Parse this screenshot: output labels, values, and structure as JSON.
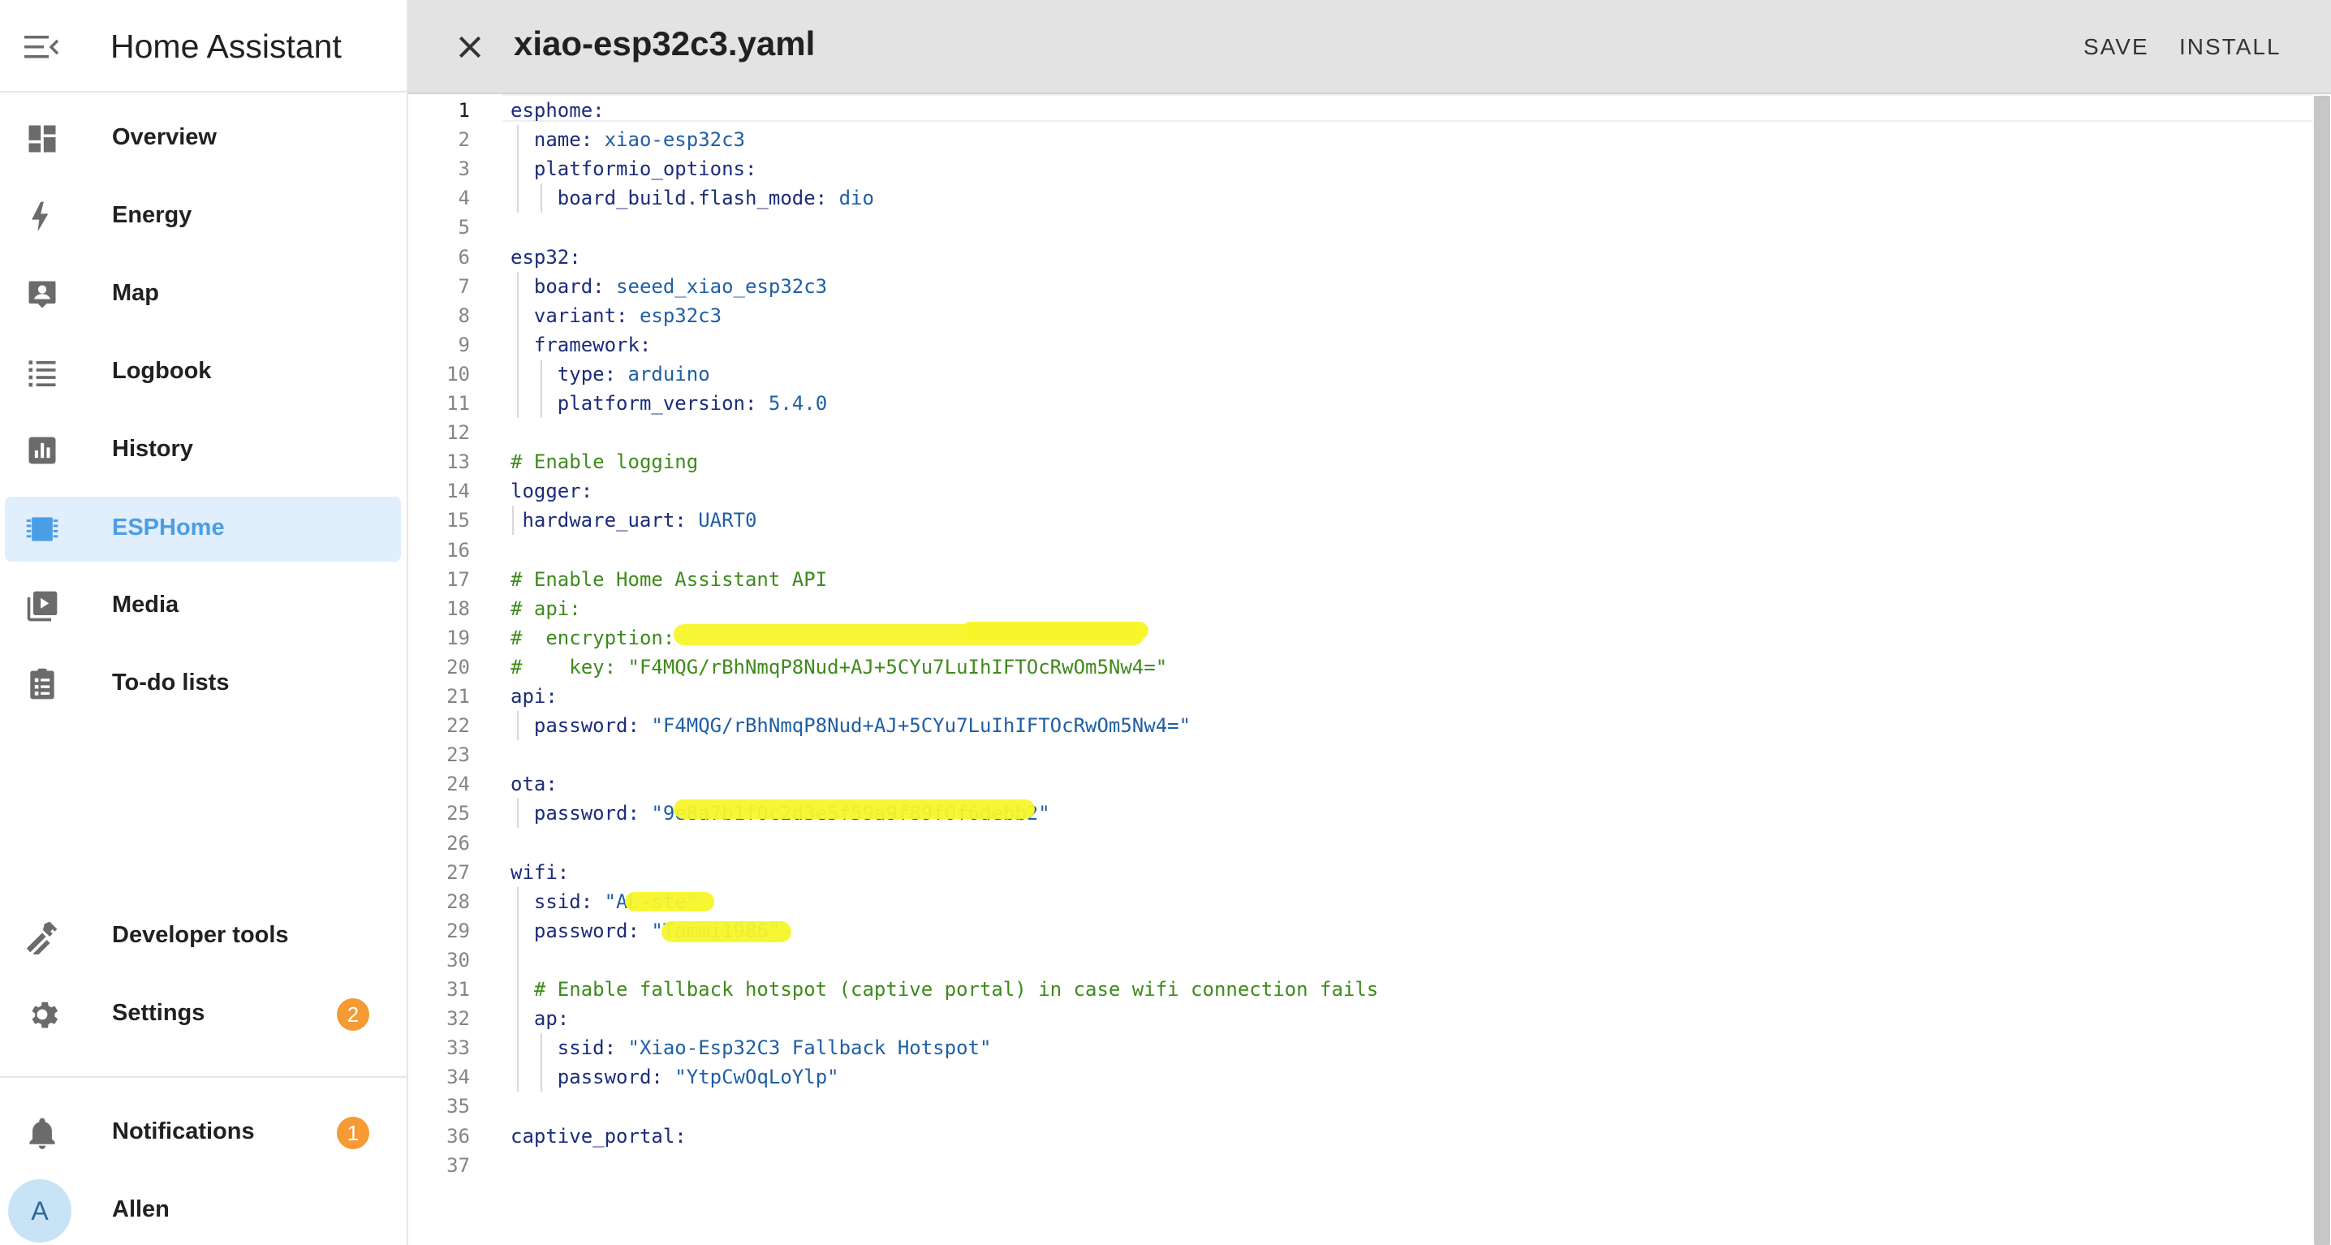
{
  "app": {
    "title": "Home Assistant"
  },
  "sidebar": {
    "items": [
      {
        "label": "Overview",
        "icon": "dashboard-icon"
      },
      {
        "label": "Energy",
        "icon": "lightning-icon"
      },
      {
        "label": "Map",
        "icon": "map-person-icon"
      },
      {
        "label": "Logbook",
        "icon": "list-icon"
      },
      {
        "label": "History",
        "icon": "chart-icon"
      },
      {
        "label": "ESPHome",
        "icon": "chip-icon",
        "active": true
      },
      {
        "label": "Media",
        "icon": "media-play-icon"
      },
      {
        "label": "To-do lists",
        "icon": "clipboard-list-icon"
      }
    ],
    "bottom": [
      {
        "label": "Developer tools",
        "icon": "hammer-icon"
      },
      {
        "label": "Settings",
        "icon": "gear-icon",
        "badge": "2"
      }
    ],
    "notifications": {
      "label": "Notifications",
      "badge": "1"
    },
    "user": {
      "name": "Allen",
      "initial": "A"
    }
  },
  "editor": {
    "filename": "xiao-esp32c3.yaml",
    "save_label": "SAVE",
    "install_label": "INSTALL",
    "current_line": 1,
    "lines": [
      {
        "n": "1",
        "k": "esphome:"
      },
      {
        "n": "2",
        "k": "name: ",
        "v": "xiao-esp32c3"
      },
      {
        "n": "3",
        "k": "platformio_options:"
      },
      {
        "n": "4",
        "k": "board_build.flash_mode: ",
        "v": "dio"
      },
      {
        "n": "5"
      },
      {
        "n": "6",
        "k": "esp32:"
      },
      {
        "n": "7",
        "k": "board: ",
        "v": "seeed_xiao_esp32c3"
      },
      {
        "n": "8",
        "k": "variant: ",
        "v": "esp32c3"
      },
      {
        "n": "9",
        "k": "framework:"
      },
      {
        "n": "10",
        "k": "type: ",
        "v": "arduino"
      },
      {
        "n": "11",
        "k": "platform_version: ",
        "v": "5.4.0"
      },
      {
        "n": "12"
      },
      {
        "n": "13",
        "c": "# Enable logging"
      },
      {
        "n": "14",
        "k": "logger:"
      },
      {
        "n": "15",
        "k": "hardware_uart: ",
        "v": "UART0"
      },
      {
        "n": "16"
      },
      {
        "n": "17",
        "c": "# Enable Home Assistant API"
      },
      {
        "n": "18",
        "c": "# api:"
      },
      {
        "n": "19",
        "c": "#  encryption:"
      },
      {
        "n": "20",
        "c": "#    key: \"F4MQG/rBhNmqP8Nud+AJ+5CYu7LuIhIFTOcRwOm5Nw4=\""
      },
      {
        "n": "21",
        "k": "api:"
      },
      {
        "n": "22",
        "k": "password: ",
        "v": "\"F4MQG/rBhNmqP8Nud+AJ+5CYu7LuIhIFTOcRwOm5Nw4=\""
      },
      {
        "n": "23"
      },
      {
        "n": "24",
        "k": "ota:"
      },
      {
        "n": "25",
        "k": "password: ",
        "v": "\"9e8a7b1f0c2d3e5f59a9f89f0f6debb2\""
      },
      {
        "n": "26"
      },
      {
        "n": "27",
        "k": "wifi:"
      },
      {
        "n": "28",
        "k": "ssid: ",
        "v": "\"AL-ste\""
      },
      {
        "n": "29",
        "k": "password: ",
        "v": "\"Tammi1986\""
      },
      {
        "n": "30"
      },
      {
        "n": "31",
        "c": "# Enable fallback hotspot (captive portal) in case wifi connection fails"
      },
      {
        "n": "32",
        "k": "ap:"
      },
      {
        "n": "33",
        "k": "ssid: ",
        "v": "\"Xiao-Esp32C3 Fallback Hotspot\""
      },
      {
        "n": "34",
        "k": "password: ",
        "v": "\"YtpCwOqLoYlp\""
      },
      {
        "n": "35"
      },
      {
        "n": "36",
        "k": "captive_portal:"
      },
      {
        "n": "37"
      }
    ]
  }
}
